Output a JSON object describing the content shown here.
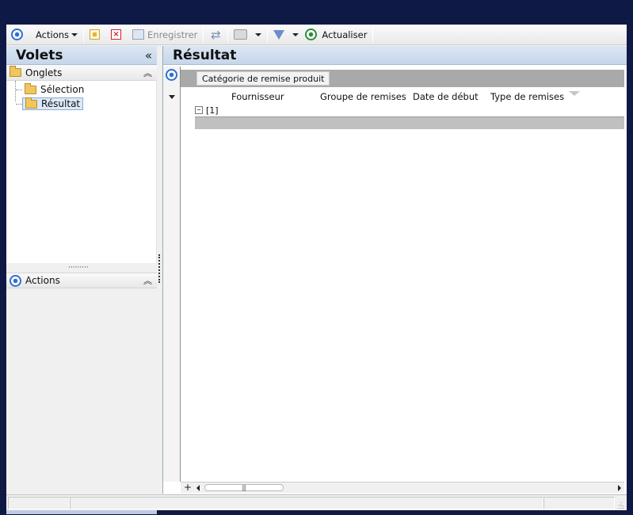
{
  "toolbar": {
    "actions_label": "Actions",
    "save_label": "Enregistrer",
    "refresh_label": "Actualiser"
  },
  "left_pane": {
    "title": "Volets",
    "tabs_section": "Onglets",
    "tree": [
      {
        "label": "Sélection",
        "selected": false
      },
      {
        "label": "Résultat",
        "selected": true
      }
    ],
    "actions_section": "Actions"
  },
  "right_pane": {
    "title": "Résultat",
    "group_by_chip": "Catégorie de remise produit",
    "columns": [
      "Fournisseur",
      "Groupe de remises",
      "Date de début",
      "Type de remises"
    ],
    "group_row_label": "[1]"
  }
}
